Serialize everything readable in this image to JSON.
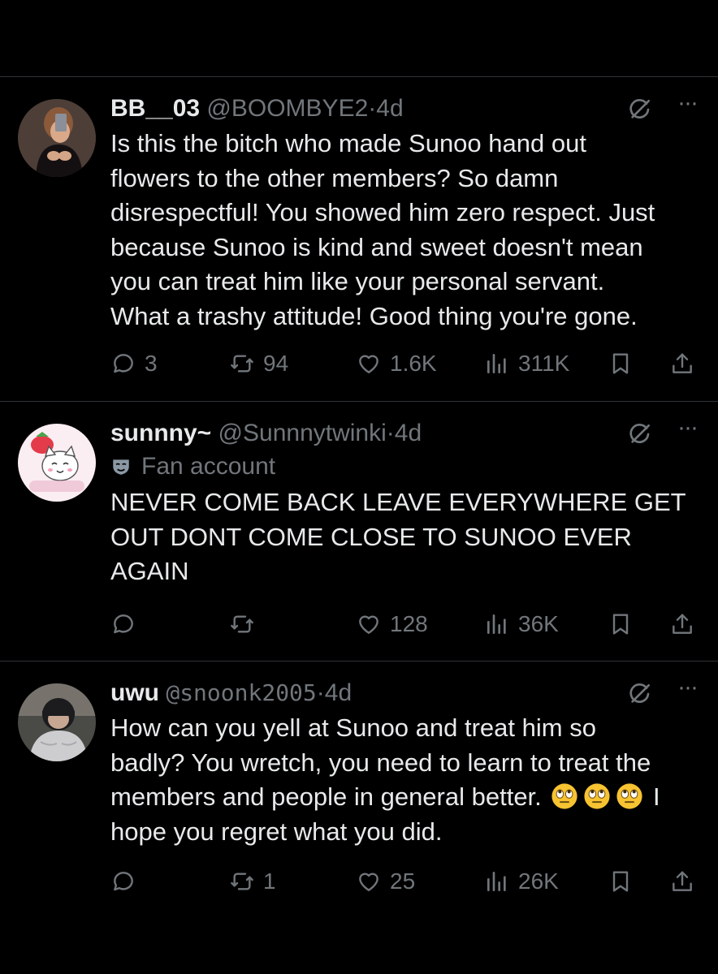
{
  "tweets": [
    {
      "name": "BB__03",
      "handle": "@BOOMBYE2",
      "separator": "·",
      "time": "4d",
      "label": "",
      "text": "Is this the bitch who made Sunoo hand out\nflowers to the other members? So damn\ndisrespectful! You showed him zero respect. Just\nbecause Sunoo is kind and sweet doesn't mean\nyou can treat him like your personal servant.\nWhat a trashy attitude! Good thing you're gone.",
      "more": "···",
      "replies": "3",
      "reposts": "94",
      "likes": "1.6K",
      "views": "311K"
    },
    {
      "name": "sunnny~",
      "handle": "@Sunnnytwinki",
      "separator": "·",
      "time": "4d",
      "label": "Fan account",
      "text": "NEVER COME BACK LEAVE EVERYWHERE GET\nOUT DONT COME CLOSE TO SUNOO EVER\nAGAIN",
      "more": "···",
      "replies": "",
      "reposts": "",
      "likes": "128",
      "views": "36K"
    },
    {
      "name": "uwu",
      "handle": "@snoonk2005",
      "separator": "·",
      "time": "4d",
      "label": "",
      "text_lines": [
        "How can you yell at Sunoo and treat him so",
        "badly? You wretch, you need to learn to treat the",
        "members and people in general better.",
        "I",
        "hope you regret what you did."
      ],
      "more": "···",
      "replies": "",
      "reposts": "1",
      "likes": "25",
      "views": "26K"
    }
  ],
  "colors": {
    "background": "#000000",
    "text": "#e7e9ea",
    "muted": "#71767b",
    "divider": "#2f3336"
  },
  "icons": [
    "reply-icon",
    "repost-icon",
    "like-icon",
    "views-icon",
    "bookmark-icon",
    "share-icon",
    "grok-icon",
    "more-icon",
    "fan-mask-icon",
    "eye-roll-emoji"
  ]
}
